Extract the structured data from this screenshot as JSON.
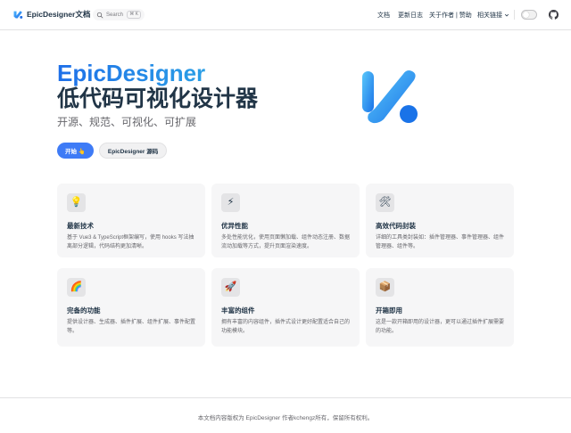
{
  "nav": {
    "brand": "EpicDesigner文档",
    "search": {
      "placeholder": "Search",
      "shortcut": "⌘ K"
    },
    "links": {
      "docs": "文档",
      "changelog": "更新日志",
      "about": "关于作者 | 赞助",
      "related": "相关链接"
    },
    "icons": {
      "logo": "epicdesigner-logo-icon",
      "search": "search-icon",
      "dropdown": "chevron-down-icon",
      "theme": "theme-toggle",
      "github": "github-icon"
    }
  },
  "hero": {
    "name": "EpicDesigner",
    "text": "低代码可视化设计器",
    "tagline": "开源、规范、可视化、可扩展",
    "actions": {
      "primary": "开始 👆",
      "secondary": "EpicDesigner 源码"
    }
  },
  "features": [
    {
      "icon": "💡",
      "icon_name": "lightbulb-icon",
      "title": "最新技术",
      "details": "基于 Vue3 & TypeScript框架编写，使用 hooks 写法抽离部分逻辑，代码结构更加清晰。"
    },
    {
      "icon": "⚡",
      "icon_name": "lightning-icon",
      "title": "优异性能",
      "details": "多处性能优化，使用页面懒加载、组件动态注册、数据流动加载等方式，提升页面渲染速度。"
    },
    {
      "icon": "🛠",
      "icon_name": "tools-icon",
      "title": "高效代码封装",
      "details": "详细的工具类封装如：插件管理器、事件管理器、组件管理器、组件等。"
    },
    {
      "icon": "🌈",
      "icon_name": "rainbow-icon",
      "title": "完备的功能",
      "details": "提供设计器、生成器、插件扩展、组件扩展、事件配置等。"
    },
    {
      "icon": "🚀",
      "icon_name": "rocket-icon",
      "title": "丰富的组件",
      "details": "拥有丰富的内容组件，插件式设计更好配置适合自己的功能模块。"
    },
    {
      "icon": "📦",
      "icon_name": "package-icon",
      "title": "开箱即用",
      "details": "这是一款开箱即用的设计器，更可以通过插件扩展需要的功能。"
    }
  ],
  "footer": {
    "copyright": "本文档内容版权为 EpicDesigner 作者kchengz所有，保留所有权利。"
  },
  "colors": {
    "brand_blue": "#3e7bf6",
    "gradient_start": "#1e6fe8",
    "gradient_end": "#2b9fe6",
    "text": "#213547",
    "muted_text": "#67676c",
    "card_bg": "#f6f6f7"
  }
}
